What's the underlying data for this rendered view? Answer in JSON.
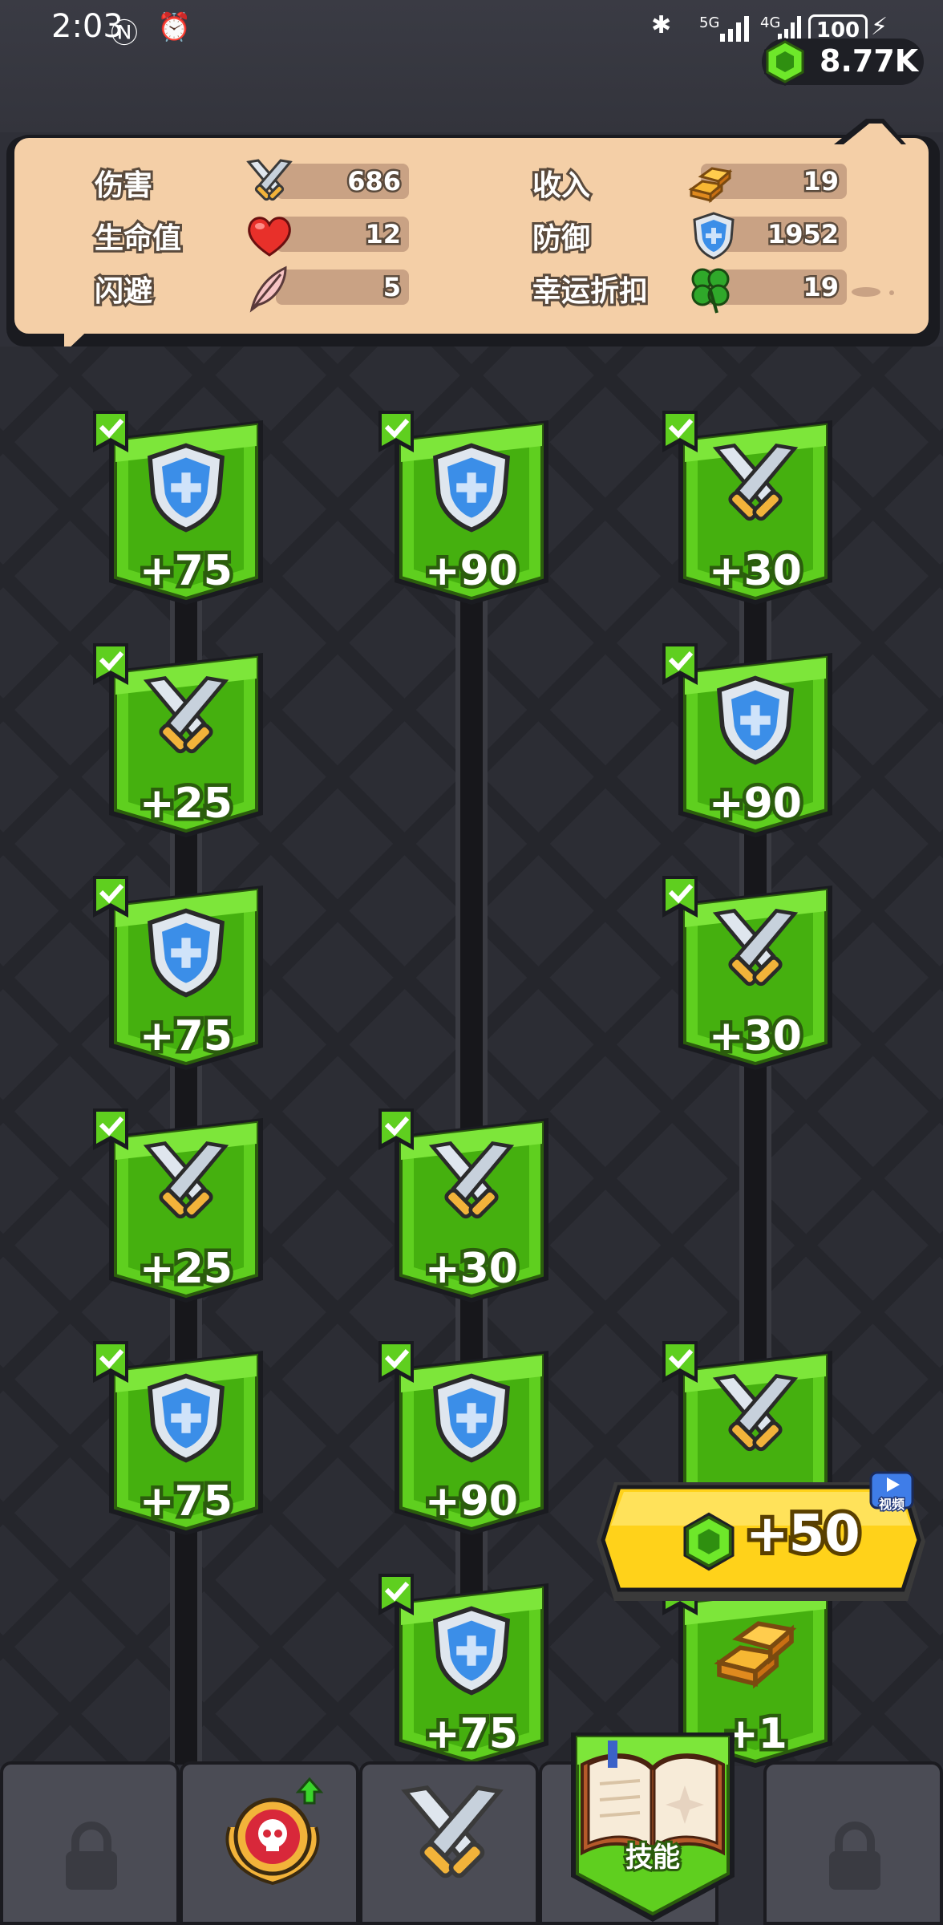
{
  "status_bar": {
    "time": "2:03",
    "battery": "100",
    "network": "5G",
    "network2": "4G"
  },
  "currency": {
    "value": "8.77K",
    "icon": "green-gem-icon"
  },
  "stats": [
    {
      "label": "伤害",
      "value": "686",
      "icon": "crossed-swords-icon"
    },
    {
      "label": "收入",
      "value": "19",
      "icon": "gold-bars-icon"
    },
    {
      "label": "生命值",
      "value": "12",
      "icon": "heart-icon"
    },
    {
      "label": "防御",
      "value": "1952",
      "icon": "shield-icon"
    },
    {
      "label": "闪避",
      "value": "5",
      "icon": "feather-icon"
    },
    {
      "label": "幸运折扣",
      "value": "19",
      "icon": "clover-icon"
    }
  ],
  "skill_tree": {
    "columns": [
      {
        "cards": [
          {
            "type": "defense",
            "icon": "shield-icon",
            "value": "+75",
            "unlocked": true
          },
          {
            "type": "attack",
            "icon": "crossed-swords-icon",
            "value": "+25",
            "unlocked": true
          },
          {
            "type": "defense",
            "icon": "shield-icon",
            "value": "+75",
            "unlocked": true
          },
          {
            "type": "attack",
            "icon": "crossed-swords-icon",
            "value": "+25",
            "unlocked": true
          },
          {
            "type": "defense",
            "icon": "shield-icon",
            "value": "+75",
            "unlocked": true
          }
        ]
      },
      {
        "cards": [
          {
            "type": "defense",
            "icon": "shield-icon",
            "value": "+90",
            "unlocked": true
          },
          {
            "type": "attack",
            "icon": "crossed-swords-icon",
            "value": "+30",
            "unlocked": true
          },
          {
            "type": "defense",
            "icon": "shield-icon",
            "value": "+90",
            "unlocked": true
          },
          {
            "type": "defense",
            "icon": "shield-icon",
            "value": "+75",
            "unlocked": true
          }
        ]
      },
      {
        "cards": [
          {
            "type": "attack",
            "icon": "crossed-swords-icon",
            "value": "+30",
            "unlocked": true
          },
          {
            "type": "defense",
            "icon": "shield-icon",
            "value": "+90",
            "unlocked": true
          },
          {
            "type": "attack",
            "icon": "crossed-swords-icon",
            "value": "+30",
            "unlocked": true
          },
          {
            "type": "attack",
            "icon": "crossed-swords-icon",
            "value": "",
            "unlocked": true
          },
          {
            "type": "income",
            "icon": "gold-bars-icon",
            "value": "+1",
            "unlocked": true
          }
        ]
      }
    ]
  },
  "reward_button": {
    "label": "+50",
    "icon": "green-gem-icon",
    "badge": "视频"
  },
  "bottom_nav": {
    "tabs": [
      {
        "name": "locked",
        "icon": "lock-icon"
      },
      {
        "name": "boss",
        "icon": "skull-emblem-icon"
      },
      {
        "name": "equipment",
        "icon": "crossed-swords-icon"
      },
      {
        "name": "skills",
        "icon": "open-book-icon",
        "label": "技能",
        "active": true
      },
      {
        "name": "locked",
        "icon": "lock-icon"
      }
    ]
  },
  "colors": {
    "card_green": "#5fcf1f",
    "card_border": "#2b5d0d",
    "panel": "#f4cfa7",
    "reward_yellow": "#ffd21a",
    "background": "#2c2d34"
  }
}
